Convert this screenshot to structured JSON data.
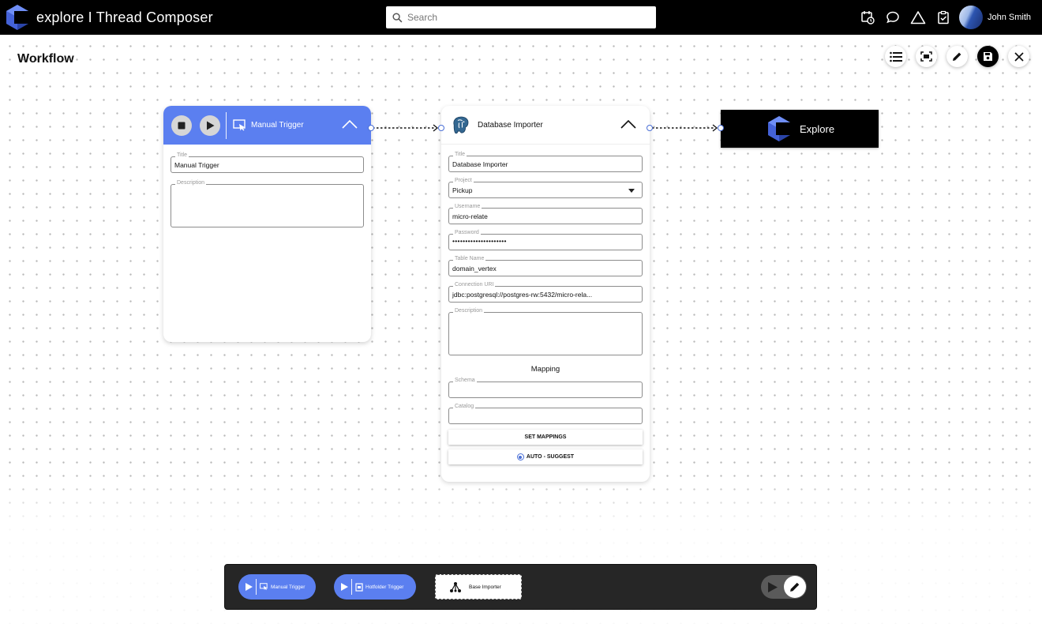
{
  "app": {
    "title": "explore I Thread Composer",
    "search_placeholder": "Search",
    "user_name": "John Smith"
  },
  "header_icons": [
    "calendar-clock-icon",
    "chat-icon",
    "warning-triangle-icon",
    "clipboard-check-icon"
  ],
  "page": {
    "title": "Workflow"
  },
  "toolbar": [
    "list-icon",
    "fit-screen-icon",
    "edit-icon",
    "save-icon",
    "close-icon"
  ],
  "nodes": {
    "manual_trigger": {
      "header_label": "Manual Trigger",
      "fields": {
        "title": {
          "label": "Title",
          "value": "Manual Trigger"
        },
        "description": {
          "label": "Description",
          "value": ""
        }
      }
    },
    "database_importer": {
      "header_label": "Database Importer",
      "fields": {
        "title": {
          "label": "Title",
          "value": "Database Importer"
        },
        "project": {
          "label": "Project",
          "value": "Pickup"
        },
        "username": {
          "label": "Username",
          "value": "micro-relate"
        },
        "password": {
          "label": "Password",
          "value": "•••••••••••••••••••••"
        },
        "table_name": {
          "label": "Table Name",
          "value": "domain_vertex"
        },
        "connection_uri": {
          "label": "Connection URI",
          "value": "jdbc:postgresql://postgres-rw:5432/micro-rela..."
        },
        "description": {
          "label": "Description",
          "value": ""
        }
      },
      "mapping": {
        "title": "Mapping",
        "schema": {
          "label": "Schema",
          "value": ""
        },
        "catalog": {
          "label": "Catalog",
          "value": ""
        },
        "set_mappings_label": "SET MAPPINGS",
        "auto_suggest_label": "AUTO - SUGGEST"
      }
    },
    "explore": {
      "label": "Explore"
    }
  },
  "palette": {
    "manual_trigger": "Manual Trigger",
    "hotfolder_trigger": "Hotfolder Trigger",
    "base_importer": "Base Importer"
  },
  "colors": {
    "accent": "#5b7ff0",
    "top_bar": "#000000",
    "palette_bg": "#262626",
    "port_blue": "#4a6fd6"
  }
}
